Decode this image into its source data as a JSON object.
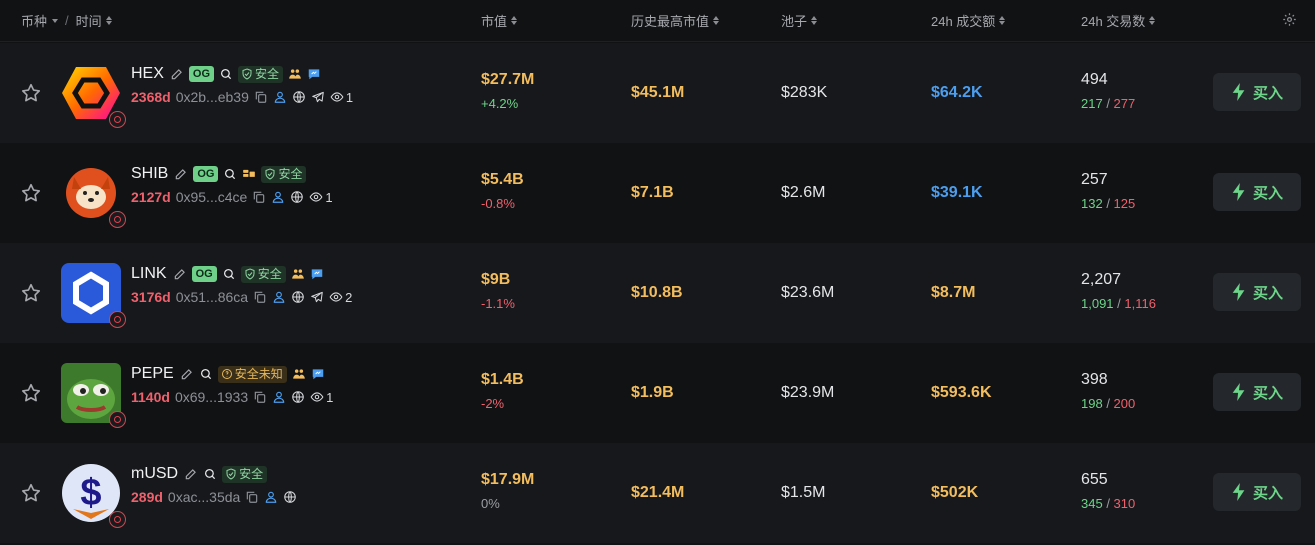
{
  "header": {
    "coin": "币种",
    "separator": "/",
    "time": "时间",
    "market_cap": "市值",
    "ath_market_cap": "历史最高市值",
    "pool": "池子",
    "volume_24h": "24h 成交额",
    "txns_24h": "24h 交易数"
  },
  "colors": {
    "background": "#111214",
    "row_alt": "#17181b",
    "gold": "#f3bd5d",
    "green": "#6dd48a",
    "red": "#f0616d",
    "blue": "#4c9ff0"
  },
  "rows": [
    {
      "symbol": "HEX",
      "og": "OG",
      "safety": "安全",
      "safety_status": "safe",
      "icons": [
        "edit-icon",
        "search-icon",
        "safe-shield-icon",
        "holders-icon",
        "chat-icon"
      ],
      "age": "2368d",
      "address": "0x2b...eb39",
      "watchers": "1",
      "links": [
        "copy-icon",
        "user-icon",
        "globe-icon",
        "telegram-icon",
        "eye-icon"
      ],
      "market_cap": "$27.7M",
      "change": "+4.2%",
      "change_dir": "up",
      "ath": "$45.1M",
      "pool": "$283K",
      "volume": "$64.2K",
      "volume_color": "blue",
      "txns": "494",
      "buys": "217",
      "sells": "277",
      "buy_label": "买入"
    },
    {
      "symbol": "SHIB",
      "og": "OG",
      "safety": "安全",
      "safety_status": "safe",
      "icons": [
        "edit-icon",
        "search-icon",
        "coins-icon",
        "safe-shield-icon"
      ],
      "age": "2127d",
      "address": "0x95...c4ce",
      "watchers": "1",
      "links": [
        "copy-icon",
        "user-icon",
        "globe-icon",
        "eye-icon"
      ],
      "market_cap": "$5.4B",
      "change": "-0.8%",
      "change_dir": "down",
      "ath": "$7.1B",
      "pool": "$2.6M",
      "volume": "$39.1K",
      "volume_color": "blue",
      "txns": "257",
      "buys": "132",
      "sells": "125",
      "buy_label": "买入"
    },
    {
      "symbol": "LINK",
      "og": "OG",
      "safety": "安全",
      "safety_status": "safe",
      "icons": [
        "edit-icon",
        "search-icon",
        "safe-shield-icon",
        "holders-icon",
        "chat-icon"
      ],
      "age": "3176d",
      "address": "0x51...86ca",
      "watchers": "2",
      "links": [
        "copy-icon",
        "user-icon",
        "globe-icon",
        "telegram-icon",
        "eye-icon"
      ],
      "market_cap": "$9B",
      "change": "-1.1%",
      "change_dir": "down",
      "ath": "$10.8B",
      "pool": "$23.6M",
      "volume": "$8.7M",
      "volume_color": "gold",
      "txns": "2,207",
      "buys": "1,091",
      "sells": "1,116",
      "buy_label": "买入"
    },
    {
      "symbol": "PEPE",
      "og": "",
      "safety": "安全未知",
      "safety_status": "unknown",
      "icons": [
        "edit-icon",
        "search-icon",
        "unknown-shield-icon",
        "holders-icon",
        "chat-icon"
      ],
      "age": "1140d",
      "address": "0x69...1933",
      "watchers": "1",
      "links": [
        "copy-icon",
        "user-icon",
        "globe-icon",
        "eye-icon"
      ],
      "market_cap": "$1.4B",
      "change": "-2%",
      "change_dir": "down",
      "ath": "$1.9B",
      "pool": "$23.9M",
      "volume": "$593.6K",
      "volume_color": "gold",
      "txns": "398",
      "buys": "198",
      "sells": "200",
      "buy_label": "买入"
    },
    {
      "symbol": "mUSD",
      "og": "",
      "safety": "安全",
      "safety_status": "safe",
      "icons": [
        "edit-icon",
        "search-icon",
        "safe-shield-icon"
      ],
      "age": "289d",
      "address": "0xac...35da",
      "watchers": "",
      "links": [
        "copy-icon",
        "user-icon",
        "globe-icon"
      ],
      "market_cap": "$17.9M",
      "change": "0%",
      "change_dir": "flat",
      "ath": "$21.4M",
      "pool": "$1.5M",
      "volume": "$502K",
      "volume_color": "gold",
      "txns": "655",
      "buys": "345",
      "sells": "310",
      "buy_label": "买入"
    }
  ]
}
